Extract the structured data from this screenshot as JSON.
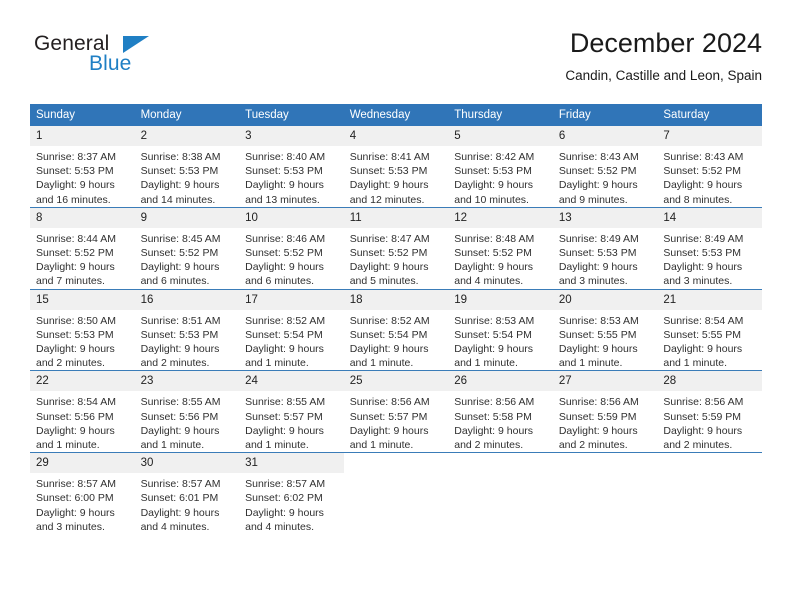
{
  "brand": {
    "name_part1": "General",
    "name_part2": "Blue",
    "triangle_color": "#1f7fc4",
    "text_color": "#231f20"
  },
  "header": {
    "title": "December 2024",
    "subtitle": "Candin, Castille and Leon, Spain"
  },
  "theme": {
    "header_bg": "#3075b8",
    "header_text": "#ffffff",
    "daynum_bg": "#f0f0f0",
    "row_divider": "#3a7cb8"
  },
  "weekdays": [
    "Sunday",
    "Monday",
    "Tuesday",
    "Wednesday",
    "Thursday",
    "Friday",
    "Saturday"
  ],
  "weeks": [
    [
      {
        "day": "1",
        "sunrise": "Sunrise: 8:37 AM",
        "sunset": "Sunset: 5:53 PM",
        "daylight1": "Daylight: 9 hours",
        "daylight2": "and 16 minutes."
      },
      {
        "day": "2",
        "sunrise": "Sunrise: 8:38 AM",
        "sunset": "Sunset: 5:53 PM",
        "daylight1": "Daylight: 9 hours",
        "daylight2": "and 14 minutes."
      },
      {
        "day": "3",
        "sunrise": "Sunrise: 8:40 AM",
        "sunset": "Sunset: 5:53 PM",
        "daylight1": "Daylight: 9 hours",
        "daylight2": "and 13 minutes."
      },
      {
        "day": "4",
        "sunrise": "Sunrise: 8:41 AM",
        "sunset": "Sunset: 5:53 PM",
        "daylight1": "Daylight: 9 hours",
        "daylight2": "and 12 minutes."
      },
      {
        "day": "5",
        "sunrise": "Sunrise: 8:42 AM",
        "sunset": "Sunset: 5:53 PM",
        "daylight1": "Daylight: 9 hours",
        "daylight2": "and 10 minutes."
      },
      {
        "day": "6",
        "sunrise": "Sunrise: 8:43 AM",
        "sunset": "Sunset: 5:52 PM",
        "daylight1": "Daylight: 9 hours",
        "daylight2": "and 9 minutes."
      },
      {
        "day": "7",
        "sunrise": "Sunrise: 8:43 AM",
        "sunset": "Sunset: 5:52 PM",
        "daylight1": "Daylight: 9 hours",
        "daylight2": "and 8 minutes."
      }
    ],
    [
      {
        "day": "8",
        "sunrise": "Sunrise: 8:44 AM",
        "sunset": "Sunset: 5:52 PM",
        "daylight1": "Daylight: 9 hours",
        "daylight2": "and 7 minutes."
      },
      {
        "day": "9",
        "sunrise": "Sunrise: 8:45 AM",
        "sunset": "Sunset: 5:52 PM",
        "daylight1": "Daylight: 9 hours",
        "daylight2": "and 6 minutes."
      },
      {
        "day": "10",
        "sunrise": "Sunrise: 8:46 AM",
        "sunset": "Sunset: 5:52 PM",
        "daylight1": "Daylight: 9 hours",
        "daylight2": "and 6 minutes."
      },
      {
        "day": "11",
        "sunrise": "Sunrise: 8:47 AM",
        "sunset": "Sunset: 5:52 PM",
        "daylight1": "Daylight: 9 hours",
        "daylight2": "and 5 minutes."
      },
      {
        "day": "12",
        "sunrise": "Sunrise: 8:48 AM",
        "sunset": "Sunset: 5:52 PM",
        "daylight1": "Daylight: 9 hours",
        "daylight2": "and 4 minutes."
      },
      {
        "day": "13",
        "sunrise": "Sunrise: 8:49 AM",
        "sunset": "Sunset: 5:53 PM",
        "daylight1": "Daylight: 9 hours",
        "daylight2": "and 3 minutes."
      },
      {
        "day": "14",
        "sunrise": "Sunrise: 8:49 AM",
        "sunset": "Sunset: 5:53 PM",
        "daylight1": "Daylight: 9 hours",
        "daylight2": "and 3 minutes."
      }
    ],
    [
      {
        "day": "15",
        "sunrise": "Sunrise: 8:50 AM",
        "sunset": "Sunset: 5:53 PM",
        "daylight1": "Daylight: 9 hours",
        "daylight2": "and 2 minutes."
      },
      {
        "day": "16",
        "sunrise": "Sunrise: 8:51 AM",
        "sunset": "Sunset: 5:53 PM",
        "daylight1": "Daylight: 9 hours",
        "daylight2": "and 2 minutes."
      },
      {
        "day": "17",
        "sunrise": "Sunrise: 8:52 AM",
        "sunset": "Sunset: 5:54 PM",
        "daylight1": "Daylight: 9 hours",
        "daylight2": "and 1 minute."
      },
      {
        "day": "18",
        "sunrise": "Sunrise: 8:52 AM",
        "sunset": "Sunset: 5:54 PM",
        "daylight1": "Daylight: 9 hours",
        "daylight2": "and 1 minute."
      },
      {
        "day": "19",
        "sunrise": "Sunrise: 8:53 AM",
        "sunset": "Sunset: 5:54 PM",
        "daylight1": "Daylight: 9 hours",
        "daylight2": "and 1 minute."
      },
      {
        "day": "20",
        "sunrise": "Sunrise: 8:53 AM",
        "sunset": "Sunset: 5:55 PM",
        "daylight1": "Daylight: 9 hours",
        "daylight2": "and 1 minute."
      },
      {
        "day": "21",
        "sunrise": "Sunrise: 8:54 AM",
        "sunset": "Sunset: 5:55 PM",
        "daylight1": "Daylight: 9 hours",
        "daylight2": "and 1 minute."
      }
    ],
    [
      {
        "day": "22",
        "sunrise": "Sunrise: 8:54 AM",
        "sunset": "Sunset: 5:56 PM",
        "daylight1": "Daylight: 9 hours",
        "daylight2": "and 1 minute."
      },
      {
        "day": "23",
        "sunrise": "Sunrise: 8:55 AM",
        "sunset": "Sunset: 5:56 PM",
        "daylight1": "Daylight: 9 hours",
        "daylight2": "and 1 minute."
      },
      {
        "day": "24",
        "sunrise": "Sunrise: 8:55 AM",
        "sunset": "Sunset: 5:57 PM",
        "daylight1": "Daylight: 9 hours",
        "daylight2": "and 1 minute."
      },
      {
        "day": "25",
        "sunrise": "Sunrise: 8:56 AM",
        "sunset": "Sunset: 5:57 PM",
        "daylight1": "Daylight: 9 hours",
        "daylight2": "and 1 minute."
      },
      {
        "day": "26",
        "sunrise": "Sunrise: 8:56 AM",
        "sunset": "Sunset: 5:58 PM",
        "daylight1": "Daylight: 9 hours",
        "daylight2": "and 2 minutes."
      },
      {
        "day": "27",
        "sunrise": "Sunrise: 8:56 AM",
        "sunset": "Sunset: 5:59 PM",
        "daylight1": "Daylight: 9 hours",
        "daylight2": "and 2 minutes."
      },
      {
        "day": "28",
        "sunrise": "Sunrise: 8:56 AM",
        "sunset": "Sunset: 5:59 PM",
        "daylight1": "Daylight: 9 hours",
        "daylight2": "and 2 minutes."
      }
    ],
    [
      {
        "day": "29",
        "sunrise": "Sunrise: 8:57 AM",
        "sunset": "Sunset: 6:00 PM",
        "daylight1": "Daylight: 9 hours",
        "daylight2": "and 3 minutes."
      },
      {
        "day": "30",
        "sunrise": "Sunrise: 8:57 AM",
        "sunset": "Sunset: 6:01 PM",
        "daylight1": "Daylight: 9 hours",
        "daylight2": "and 4 minutes."
      },
      {
        "day": "31",
        "sunrise": "Sunrise: 8:57 AM",
        "sunset": "Sunset: 6:02 PM",
        "daylight1": "Daylight: 9 hours",
        "daylight2": "and 4 minutes."
      },
      {
        "day": "",
        "sunrise": "",
        "sunset": "",
        "daylight1": "",
        "daylight2": ""
      },
      {
        "day": "",
        "sunrise": "",
        "sunset": "",
        "daylight1": "",
        "daylight2": ""
      },
      {
        "day": "",
        "sunrise": "",
        "sunset": "",
        "daylight1": "",
        "daylight2": ""
      },
      {
        "day": "",
        "sunrise": "",
        "sunset": "",
        "daylight1": "",
        "daylight2": ""
      }
    ]
  ]
}
